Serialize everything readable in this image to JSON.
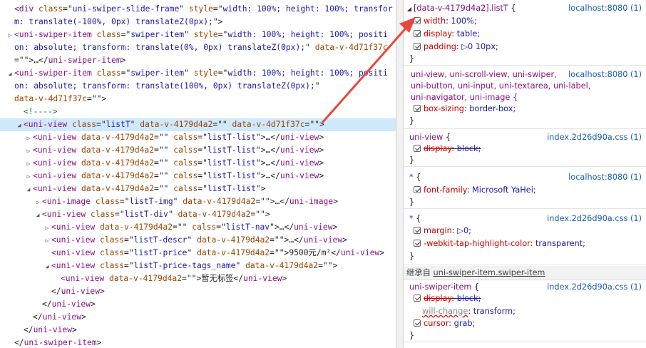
{
  "tree": [
    {
      "indent": 0,
      "tri": "",
      "parts": [
        [
          "tag",
          "<div "
        ],
        [
          "attr",
          "class"
        ],
        [
          "txt",
          "=\""
        ],
        [
          "val",
          "uni-swiper-slide-frame"
        ],
        [
          "txt",
          "\" "
        ],
        [
          "attr",
          "style"
        ],
        [
          "txt",
          "=\""
        ],
        [
          "val",
          "width: 100%; height: 100%; transfor"
        ]
      ]
    },
    {
      "indent": 0,
      "tri": "",
      "parts": [
        [
          "val",
          "m: translate(-100%, 0px) translateZ(0px);"
        ],
        [
          "txt",
          "\">"
        ]
      ]
    },
    {
      "indent": 0,
      "tri": "▷",
      "parts": [
        [
          "tag",
          "<uni-swiper-item "
        ],
        [
          "attr",
          "class"
        ],
        [
          "txt",
          "=\""
        ],
        [
          "val",
          "swiper-item"
        ],
        [
          "txt",
          "\" "
        ],
        [
          "attr",
          "style"
        ],
        [
          "txt",
          "=\""
        ],
        [
          "val",
          "width: 100%; height: 100%; positi"
        ]
      ]
    },
    {
      "indent": 0,
      "tri": "",
      "parts": [
        [
          "val",
          "on: absolute; transform: translate(0%, 0px) translateZ(0px);"
        ],
        [
          "txt",
          "\" "
        ],
        [
          "attr",
          "data-v-4d71f37c"
        ]
      ]
    },
    {
      "indent": 0,
      "tri": "",
      "parts": [
        [
          "txt",
          "=\"\">…</"
        ],
        [
          "tag",
          "uni-swiper-item"
        ],
        [
          "txt",
          ">"
        ]
      ]
    },
    {
      "indent": 0,
      "tri": "◢",
      "parts": [
        [
          "tag",
          "<uni-swiper-item "
        ],
        [
          "attr",
          "class"
        ],
        [
          "txt",
          "=\""
        ],
        [
          "val",
          "swiper-item"
        ],
        [
          "txt",
          "\" "
        ],
        [
          "attr",
          "style"
        ],
        [
          "txt",
          "=\""
        ],
        [
          "val",
          "width: 100%; height: 100%; positi"
        ]
      ]
    },
    {
      "indent": 0,
      "tri": "",
      "parts": [
        [
          "val",
          "on: absolute; transform: translate(100%, 0px) translateZ(0px);"
        ],
        [
          "txt",
          "\""
        ]
      ]
    },
    {
      "indent": 0,
      "tri": "",
      "parts": [
        [
          "attr",
          "data-v-4d71f37c"
        ],
        [
          "txt",
          "=\"\">"
        ]
      ]
    },
    {
      "indent": 1,
      "tri": "",
      "parts": [
        [
          "cmt",
          "<!---->"
        ]
      ]
    },
    {
      "indent": 1,
      "tri": "◢",
      "sel": true,
      "parts": [
        [
          "tag",
          "<uni-view "
        ],
        [
          "attr",
          "class"
        ],
        [
          "txt",
          "=\""
        ],
        [
          "val",
          "listT"
        ],
        [
          "txt",
          "\" "
        ],
        [
          "attr",
          "data-v-4179d4a2"
        ],
        [
          "txt",
          "=\"\" "
        ],
        [
          "attr",
          "data-v-4d71f37c"
        ],
        [
          "txt",
          "=\"\">"
        ]
      ]
    },
    {
      "indent": 2,
      "tri": "▷",
      "parts": [
        [
          "tag",
          "<uni-view "
        ],
        [
          "attr",
          "data-v-4179d4a2"
        ],
        [
          "txt",
          "=\"\" "
        ],
        [
          "attr",
          "calss"
        ],
        [
          "txt",
          "=\""
        ],
        [
          "val",
          "listT-list"
        ],
        [
          "txt",
          "\">…</"
        ],
        [
          "tag",
          "uni-view"
        ],
        [
          "txt",
          ">"
        ]
      ]
    },
    {
      "indent": 2,
      "tri": "▷",
      "parts": [
        [
          "tag",
          "<uni-view "
        ],
        [
          "attr",
          "data-v-4179d4a2"
        ],
        [
          "txt",
          "=\"\" "
        ],
        [
          "attr",
          "calss"
        ],
        [
          "txt",
          "=\""
        ],
        [
          "val",
          "listT-list"
        ],
        [
          "txt",
          "\">…</"
        ],
        [
          "tag",
          "uni-view"
        ],
        [
          "txt",
          ">"
        ]
      ]
    },
    {
      "indent": 2,
      "tri": "▷",
      "parts": [
        [
          "tag",
          "<uni-view "
        ],
        [
          "attr",
          "data-v-4179d4a2"
        ],
        [
          "txt",
          "=\"\" "
        ],
        [
          "attr",
          "calss"
        ],
        [
          "txt",
          "=\""
        ],
        [
          "val",
          "listT-list"
        ],
        [
          "txt",
          "\">…</"
        ],
        [
          "tag",
          "uni-view"
        ],
        [
          "txt",
          ">"
        ]
      ]
    },
    {
      "indent": 2,
      "tri": "▷",
      "parts": [
        [
          "tag",
          "<uni-view "
        ],
        [
          "attr",
          "data-v-4179d4a2"
        ],
        [
          "txt",
          "=\"\" "
        ],
        [
          "attr",
          "calss"
        ],
        [
          "txt",
          "=\""
        ],
        [
          "val",
          "listT-list"
        ],
        [
          "txt",
          "\">…</"
        ],
        [
          "tag",
          "uni-view"
        ],
        [
          "txt",
          ">"
        ]
      ]
    },
    {
      "indent": 2,
      "tri": "◢",
      "parts": [
        [
          "tag",
          "<uni-view "
        ],
        [
          "attr",
          "data-v-4179d4a2"
        ],
        [
          "txt",
          "=\"\" "
        ],
        [
          "attr",
          "calss"
        ],
        [
          "txt",
          "=\""
        ],
        [
          "val",
          "listT-list"
        ],
        [
          "txt",
          "\">"
        ]
      ]
    },
    {
      "indent": 3,
      "tri": "▷",
      "parts": [
        [
          "tag",
          "<uni-image "
        ],
        [
          "attr",
          "class"
        ],
        [
          "txt",
          "=\""
        ],
        [
          "val",
          "listT-img"
        ],
        [
          "txt",
          "\" "
        ],
        [
          "attr",
          "data-v-4179d4a2"
        ],
        [
          "txt",
          "=\"\">…</"
        ],
        [
          "tag",
          "uni-image"
        ],
        [
          "txt",
          ">"
        ]
      ]
    },
    {
      "indent": 3,
      "tri": "◢",
      "parts": [
        [
          "tag",
          "<uni-view "
        ],
        [
          "attr",
          "class"
        ],
        [
          "txt",
          "=\""
        ],
        [
          "val",
          "listT-div"
        ],
        [
          "txt",
          "\" "
        ],
        [
          "attr",
          "data-v-4179d4a2"
        ],
        [
          "txt",
          "=\"\">"
        ]
      ]
    },
    {
      "indent": 4,
      "tri": "▷",
      "parts": [
        [
          "tag",
          "<uni-view "
        ],
        [
          "attr",
          "data-v-4179d4a2"
        ],
        [
          "txt",
          "=\"\" "
        ],
        [
          "attr",
          "calss"
        ],
        [
          "txt",
          "=\""
        ],
        [
          "val",
          "listT-nav"
        ],
        [
          "txt",
          "\">…</"
        ],
        [
          "tag",
          "uni-view"
        ],
        [
          "txt",
          ">"
        ]
      ]
    },
    {
      "indent": 4,
      "tri": "▷",
      "parts": [
        [
          "tag",
          "<uni-view "
        ],
        [
          "attr",
          "class"
        ],
        [
          "txt",
          "=\""
        ],
        [
          "val",
          "listT-descr"
        ],
        [
          "txt",
          "\" "
        ],
        [
          "attr",
          "data-v-4179d4a2"
        ],
        [
          "txt",
          "=\"\">…</"
        ],
        [
          "tag",
          "uni-view"
        ],
        [
          "txt",
          ">"
        ]
      ]
    },
    {
      "indent": 4,
      "tri": "",
      "parts": [
        [
          "tag",
          "<uni-view "
        ],
        [
          "attr",
          "class"
        ],
        [
          "txt",
          "=\""
        ],
        [
          "val",
          "listT-price"
        ],
        [
          "txt",
          "\" "
        ],
        [
          "attr",
          "data-v-4179d4a2"
        ],
        [
          "txt",
          "=\"\">9500元/m²</"
        ],
        [
          "tag",
          "uni-view"
        ],
        [
          "txt",
          ">"
        ]
      ]
    },
    {
      "indent": 4,
      "tri": "◢",
      "parts": [
        [
          "tag",
          "<uni-view "
        ],
        [
          "attr",
          "class"
        ],
        [
          "txt",
          "=\""
        ],
        [
          "val",
          "listT-price-tags_name"
        ],
        [
          "txt",
          "\" "
        ],
        [
          "attr",
          "data-v-4179d4a2"
        ],
        [
          "txt",
          "=\"\">"
        ]
      ]
    },
    {
      "indent": 5,
      "tri": "",
      "parts": [
        [
          "tag",
          "<uni-view "
        ],
        [
          "attr",
          "data-v-4179d4a2"
        ],
        [
          "txt",
          "=\"\">暂无标签</"
        ],
        [
          "tag",
          "uni-view"
        ],
        [
          "txt",
          ">"
        ]
      ]
    },
    {
      "indent": 4,
      "tri": "",
      "parts": [
        [
          "txt",
          "</"
        ],
        [
          "tag",
          "uni-view"
        ],
        [
          "txt",
          ">"
        ]
      ]
    },
    {
      "indent": 3,
      "tri": "",
      "parts": [
        [
          "txt",
          "</"
        ],
        [
          "tag",
          "uni-view"
        ],
        [
          "txt",
          ">"
        ]
      ]
    },
    {
      "indent": 2,
      "tri": "",
      "parts": [
        [
          "txt",
          "</"
        ],
        [
          "tag",
          "uni-view"
        ],
        [
          "txt",
          ">"
        ]
      ]
    },
    {
      "indent": 1,
      "tri": "",
      "parts": [
        [
          "txt",
          "</"
        ],
        [
          "tag",
          "uni-view"
        ],
        [
          "txt",
          ">"
        ]
      ]
    },
    {
      "indent": 0,
      "tri": "",
      "parts": [
        [
          "txt",
          "</"
        ],
        [
          "tag",
          "uni-swiper-item"
        ],
        [
          "txt",
          ">"
        ]
      ]
    }
  ],
  "styles": {
    "rule1": {
      "selector": "[data-v-4179d4a2].listT",
      "brace": " {",
      "source": "localhost:8080 (1)",
      "props": [
        [
          "width",
          "100%;"
        ],
        [
          "display",
          "table;"
        ],
        [
          "padding",
          "▷0 10px;"
        ]
      ]
    },
    "rule2": {
      "selector_lines": [
        "uni-view, uni-scroll-view, uni-swiper,",
        "uni-button, uni-input, uni-textarea, uni-label,",
        "uni-navigator, uni-image  {"
      ],
      "source": "localhost:8080 (1)",
      "props": [
        [
          "box-sizing",
          "border-box;"
        ]
      ]
    },
    "rule3": {
      "selector": "uni-view",
      "brace": "  {",
      "source": "index.2d26d90a.css (1)",
      "props": [
        [
          "display",
          "block;"
        ]
      ]
    },
    "rule4": {
      "selector": "*",
      "brace": "  {",
      "source": "localhost:8080 (1)",
      "props": [
        [
          "font-family",
          "Microsoft YaHei;"
        ]
      ]
    },
    "rule5": {
      "selector": "*",
      "brace": "  {",
      "source": "index.2d26d90a.css (1)",
      "props": [
        [
          "margin",
          "▷0;"
        ],
        [
          "-webkit-tap-highlight-color",
          "transparent;"
        ]
      ]
    },
    "inherited_prefix": "继承自",
    "inherited_from": "uni-swiper-item.swiper-item",
    "rule6": {
      "selector": "uni-swiper-item",
      "brace": "  {",
      "source": "index.2d26d90a.css (1)",
      "props": [
        [
          "display",
          "block;"
        ],
        [
          "will-change",
          "transform;"
        ],
        [
          "cursor",
          "grab;"
        ]
      ]
    },
    "close_brace": "}"
  },
  "arrow_color": "#e8473d"
}
